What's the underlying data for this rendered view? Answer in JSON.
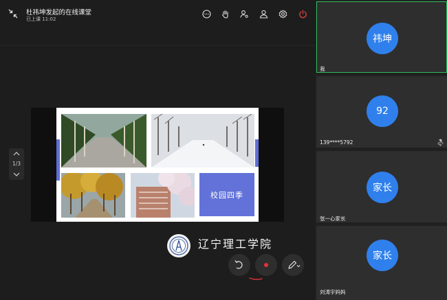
{
  "header": {
    "title": "杜祎坤发起的在线课堂",
    "subtitle": "已上课 11:02"
  },
  "toolbar_icons": [
    "chat-icon",
    "raise-hand-icon",
    "member-management-icon",
    "user-icon",
    "gear-icon",
    "power-icon"
  ],
  "slide": {
    "caption": "校园四季",
    "page": "1/3",
    "photos": [
      "summer-tree-lined-road",
      "winter-snowy-tree-lined-road",
      "autumn-yellow-trees",
      "spring-blossom-campus"
    ]
  },
  "watermark": {
    "text": "辽宁理工学院"
  },
  "controls": {
    "undo_icon": "undo-icon",
    "record_icon": "record-icon",
    "pen_icon": "pen-icon"
  },
  "participants": [
    {
      "avatar": "祎坤",
      "name": "我",
      "active": true
    },
    {
      "avatar": "92",
      "name": "139****5792",
      "muted": true
    },
    {
      "avatar": "家长",
      "name": "张一心家长"
    },
    {
      "avatar": "家长",
      "name": "刘涛宇妈妈"
    }
  ],
  "colors": {
    "accent_blue": "#2f80ec",
    "active_border": "#2fbf5f",
    "record_red": "#e8313b",
    "power_red": "#e04040",
    "slide_accent": "#6272d9"
  }
}
